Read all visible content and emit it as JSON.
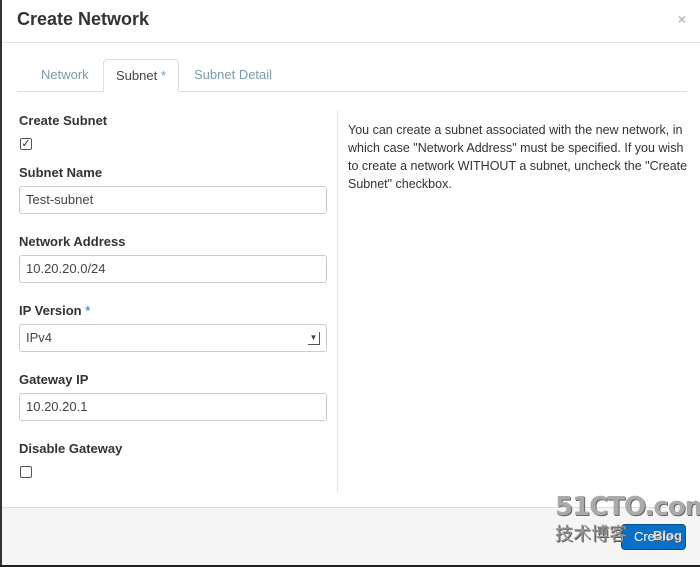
{
  "dialog": {
    "title": "Create Network",
    "close_label": "×"
  },
  "tabs": [
    {
      "label": "Network"
    },
    {
      "label": "Subnet",
      "required": "*"
    },
    {
      "label": "Subnet Detail"
    }
  ],
  "form": {
    "create_subnet": {
      "label": "Create Subnet",
      "checked": true
    },
    "subnet_name": {
      "label": "Subnet Name",
      "value": "Test-subnet"
    },
    "network_address": {
      "label": "Network Address",
      "value": "10.20.20.0/24"
    },
    "ip_version": {
      "label": "IP Version",
      "required": "*",
      "value": "IPv4"
    },
    "gateway_ip": {
      "label": "Gateway IP",
      "value": "10.20.20.1"
    },
    "disable_gateway": {
      "label": "Disable Gateway",
      "checked": false
    }
  },
  "help_text": "You can create a subnet associated with the new network, in which case \"Network Address\" must be specified. If you wish to create a network WITHOUT a subnet, uncheck the \"Create Subnet\" checkbox.",
  "footer": {
    "create_label": "Create"
  },
  "watermark": {
    "line1": "51CTO.com",
    "line2": "技术博客",
    "line3": "Blog"
  },
  "colors": {
    "primary": "#0a6fc7",
    "required": "#5a9ecf"
  }
}
